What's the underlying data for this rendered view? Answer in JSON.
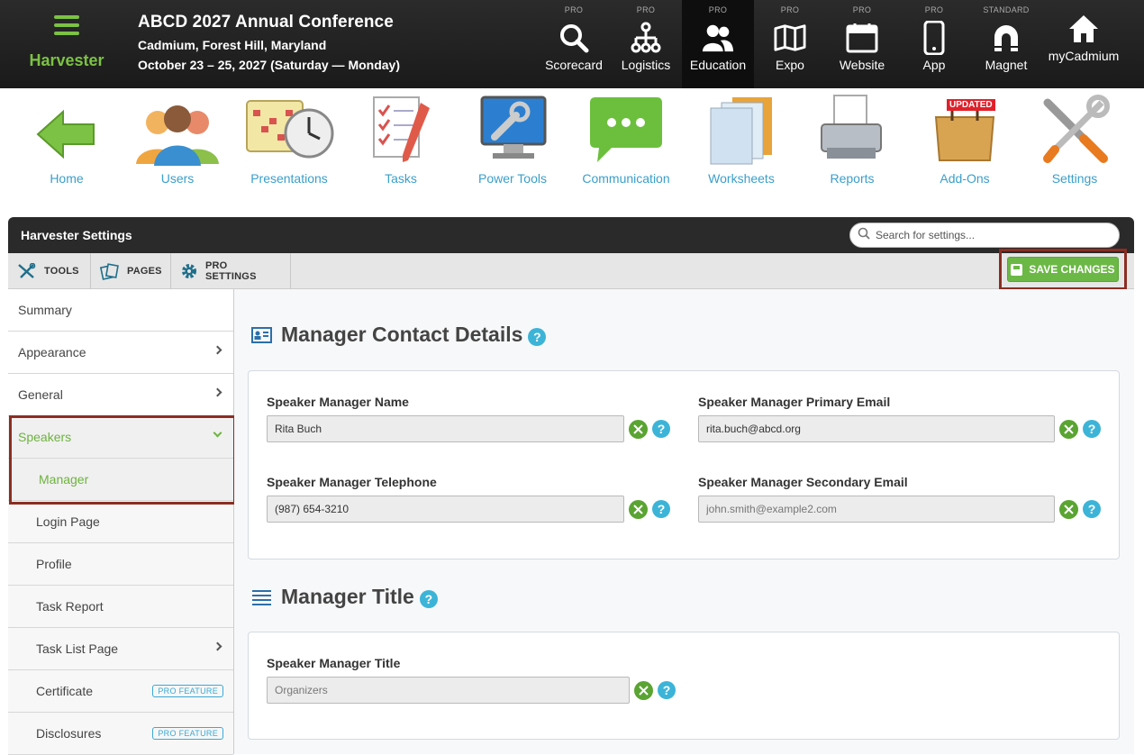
{
  "brand": {
    "name": "Harvester"
  },
  "conference": {
    "title": "ABCD 2027 Annual Conference",
    "location": "Cadmium, Forest Hill, Maryland",
    "dates": "October 23 – 25, 2027 (Saturday — Monday)"
  },
  "modules": [
    {
      "tier": "PRO",
      "label": "Scorecard",
      "icon": "search-icon"
    },
    {
      "tier": "PRO",
      "label": "Logistics",
      "icon": "network-icon"
    },
    {
      "tier": "PRO",
      "label": "Education",
      "icon": "people-icon",
      "active": true
    },
    {
      "tier": "PRO",
      "label": "Expo",
      "icon": "map-icon"
    },
    {
      "tier": "PRO",
      "label": "Website",
      "icon": "browser-icon"
    },
    {
      "tier": "PRO",
      "label": "App",
      "icon": "phone-icon"
    },
    {
      "tier": "STANDARD",
      "label": "Magnet",
      "icon": "magnet-icon"
    },
    {
      "tier": "",
      "label": "myCadmium",
      "icon": "home-icon"
    }
  ],
  "apps": [
    {
      "label": "Home",
      "icon": "green-arrow-icon"
    },
    {
      "label": "Users",
      "icon": "users-icon"
    },
    {
      "label": "Presentations",
      "icon": "calendar-clock-icon"
    },
    {
      "label": "Tasks",
      "icon": "checklist-icon"
    },
    {
      "label": "Power Tools",
      "icon": "monitor-wrench-icon"
    },
    {
      "label": "Communication",
      "icon": "chat-bubble-icon"
    },
    {
      "label": "Worksheets",
      "icon": "folder-icon"
    },
    {
      "label": "Reports",
      "icon": "printer-icon"
    },
    {
      "label": "Add-Ons",
      "icon": "shopping-bag-icon",
      "badge": "UPDATED"
    },
    {
      "label": "Settings",
      "icon": "tools-icon"
    }
  ],
  "panel": {
    "title": "Harvester Settings",
    "search_placeholder": "Search for settings...",
    "tabs": [
      {
        "label": "TOOLS",
        "icon": "tools-icon"
      },
      {
        "label": "PAGES",
        "icon": "pages-icon"
      },
      {
        "label": "PRO SETTINGS",
        "icon": "gear-icon"
      }
    ],
    "save_label": "SAVE CHANGES"
  },
  "sidebar": {
    "items": [
      {
        "label": "Summary"
      },
      {
        "label": "Appearance"
      },
      {
        "label": "General"
      },
      {
        "label": "Speakers"
      },
      {
        "label": "Manager"
      },
      {
        "label": "Login Page"
      },
      {
        "label": "Profile"
      },
      {
        "label": "Task Report"
      },
      {
        "label": "Task List Page"
      },
      {
        "label": "Certificate",
        "badge": "PRO FEATURE"
      },
      {
        "label": "Disclosures",
        "badge": "PRO FEATURE"
      }
    ]
  },
  "sections": {
    "contact": {
      "title": "Manager Contact Details",
      "fields": {
        "name": {
          "label": "Speaker Manager Name",
          "value": "Rita Buch"
        },
        "primary_email": {
          "label": "Speaker Manager Primary Email",
          "value": "rita.buch@abcd.org"
        },
        "telephone": {
          "label": "Speaker Manager Telephone",
          "value": "(987) 654-3210"
        },
        "secondary_email": {
          "label": "Speaker Manager Secondary Email",
          "placeholder": "john.smith@example2.com"
        }
      }
    },
    "title_section": {
      "title": "Manager Title",
      "fields": {
        "title": {
          "label": "Speaker Manager Title",
          "placeholder": "Organizers"
        }
      }
    }
  },
  "help_glyph": "?",
  "colors": {
    "brand_green": "#7cc244",
    "link_blue": "#3a9fc9",
    "save_green": "#6cb846",
    "highlight": "#8b2d22",
    "help_blue": "#3cb4d8"
  }
}
